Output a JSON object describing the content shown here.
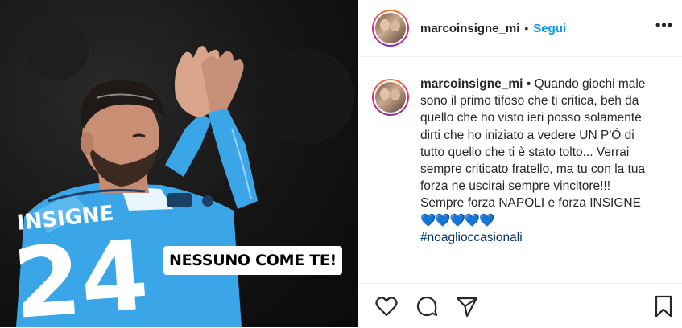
{
  "media": {
    "overlay_text": "NESSUNO COME TE!"
  },
  "header": {
    "username": "marcoinsigne_mi",
    "separator": "•",
    "follow_label": "Segui",
    "more_label": "•••"
  },
  "caption": {
    "username": "marcoinsigne_mi",
    "separator": "•",
    "text": "Quando giochi male sono il primo tifoso che ti critica, beh da quello che ho visto ieri posso solamente dirti che ho iniziato a vedere UN P'Ó di tutto quello che ti è stato tolto... Verrai sempre criticato fratello, ma tu con la tua forza ne uscirai sempre vincitore!!! Sempre forza NAPOLI e forza INSIGNE",
    "emojis": "💙💙💙💙💙",
    "hashtag": "#noaglioccasionali"
  },
  "actions": {
    "like_icon": "heart-icon",
    "comment_icon": "comment-icon",
    "share_icon": "share-icon",
    "save_icon": "bookmark-icon"
  },
  "colors": {
    "follow": "#0095f6",
    "hearts": "#12c2d4",
    "hashtag": "#00376b",
    "jersey": "#3aa6e8"
  }
}
